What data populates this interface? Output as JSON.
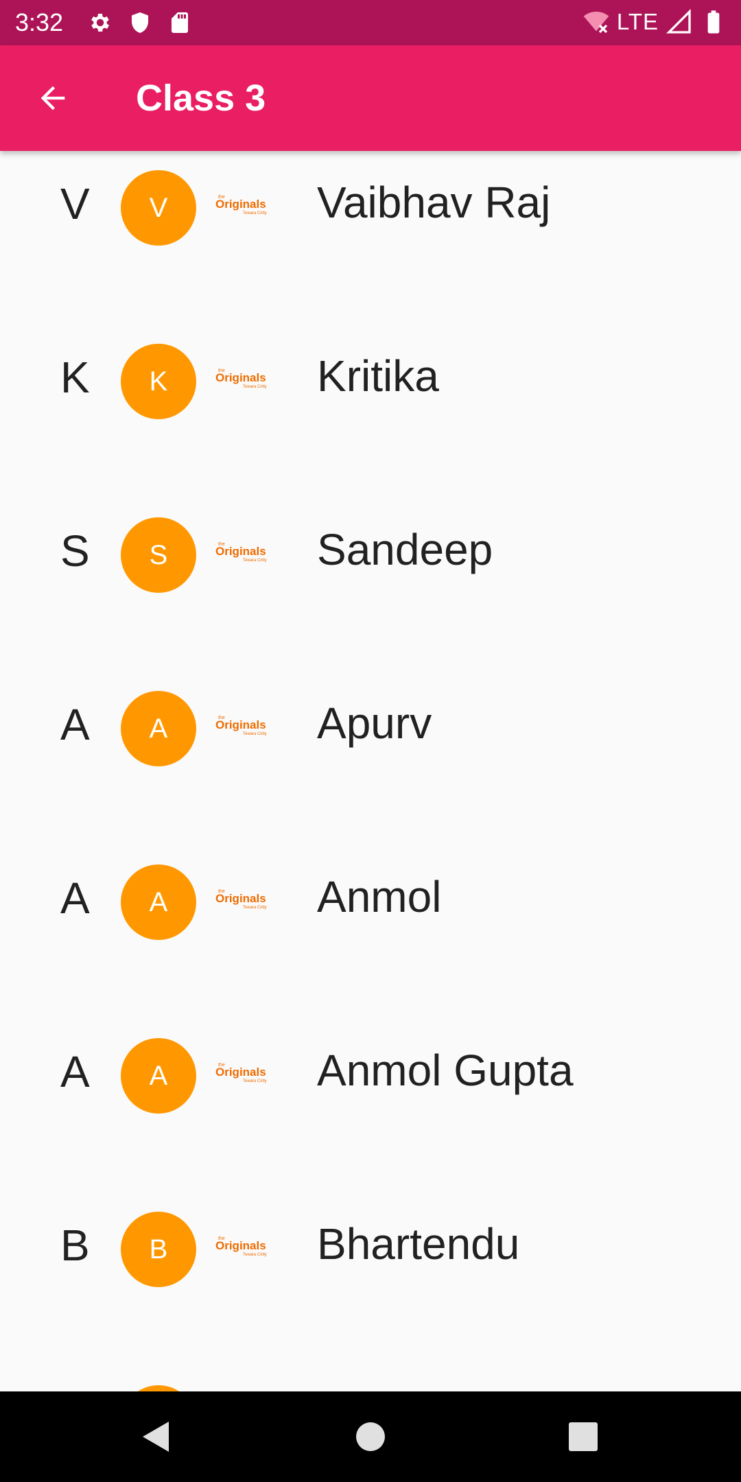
{
  "status_bar": {
    "time": "3:32",
    "network": "LTE",
    "icons": [
      "settings-icon",
      "shield-icon",
      "sd-card-icon",
      "wifi-off-icon",
      "signal-icon",
      "battery-icon"
    ]
  },
  "app_bar": {
    "title": "Class 3",
    "back_icon": "arrow-back-icon",
    "color": "#e91e63",
    "status_color": "#ad1457"
  },
  "logo": {
    "small": "the",
    "main": "Originals",
    "sub": "Tewara Cirtly"
  },
  "students": [
    {
      "initial": "V",
      "avatar": "V",
      "name": "Vaibhav Raj"
    },
    {
      "initial": "K",
      "avatar": "K",
      "name": "Kritika"
    },
    {
      "initial": "S",
      "avatar": "S",
      "name": "Sandeep"
    },
    {
      "initial": "A",
      "avatar": "A",
      "name": "Apurv"
    },
    {
      "initial": "A",
      "avatar": "A",
      "name": "Anmol"
    },
    {
      "initial": "A",
      "avatar": "A",
      "name": "Anmol Gupta"
    },
    {
      "initial": "B",
      "avatar": "B",
      "name": "Bhartendu"
    },
    {
      "initial": "",
      "avatar": "",
      "name": ""
    }
  ],
  "avatar_color": "#ff9800",
  "nav": {
    "back": "nav-back-icon",
    "home": "nav-home-icon",
    "recents": "nav-recents-icon"
  }
}
